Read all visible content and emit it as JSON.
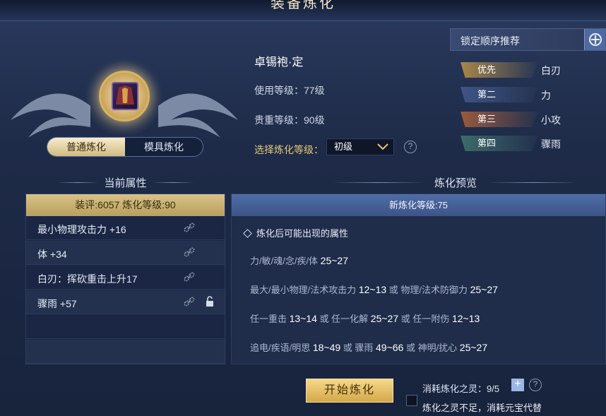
{
  "window": {
    "title": "装备炼化"
  },
  "mode_tabs": [
    {
      "label": "普通炼化",
      "active": true
    },
    {
      "label": "模具炼化",
      "active": false
    }
  ],
  "item": {
    "name": "卓锡袍·定",
    "use_level": "使用等级：77级",
    "value_level": "贵重等级：90级",
    "refine_level_label": "选择炼化等级：",
    "refine_level_selected": "初级"
  },
  "lock_order": {
    "title": "锁定顺序推荐",
    "rows": [
      {
        "tag": "优先",
        "value": "白刃",
        "color": "#a8874a"
      },
      {
        "tag": "第二",
        "value": "力",
        "color": "#3e5585"
      },
      {
        "tag": "第三",
        "value": "小攻",
        "color": "#9a5a3e"
      },
      {
        "tag": "第四",
        "value": "骤雨",
        "color": "#3d6b6a"
      }
    ]
  },
  "current": {
    "heading": "当前属性",
    "header": "装评:6057  炼化等级:90",
    "rows": [
      {
        "text": "最小物理攻击力 +16",
        "locked": false
      },
      {
        "text": "体 +34",
        "locked": false
      },
      {
        "text": "白刃：挥砍重击上升17",
        "locked": false
      },
      {
        "text": "骤雨 +57",
        "locked": true
      }
    ]
  },
  "preview": {
    "heading": "炼化预览",
    "header": "新炼化等级:75",
    "subtitle": "炼化后可能出现的属性",
    "lines": [
      [
        {
          "t": "力/敏/魂/念/疾/体 "
        },
        {
          "t": "25~27",
          "n": true
        }
      ],
      [
        {
          "t": "最大/最小物理/法术攻击力 "
        },
        {
          "t": "12~13",
          "n": true
        },
        {
          "t": " 或 物理/法术防御力 "
        },
        {
          "t": "25~27",
          "n": true
        }
      ],
      [
        {
          "t": "任一重击 "
        },
        {
          "t": "13~14",
          "n": true
        },
        {
          "t": " 或 任一化解 "
        },
        {
          "t": "25~27",
          "n": true
        },
        {
          "t": " 或 任一附伤 "
        },
        {
          "t": "12~13",
          "n": true
        }
      ],
      [
        {
          "t": "追电/疾语/明思 "
        },
        {
          "t": "18~49",
          "n": true
        },
        {
          "t": " 或 骤雨 "
        },
        {
          "t": "49~66",
          "n": true
        },
        {
          "t": " 或 神明/扰心 "
        },
        {
          "t": "25~27",
          "n": true
        }
      ]
    ]
  },
  "bottom": {
    "start_label": "开始炼化",
    "cost_label": "消耗炼化之灵：",
    "cost_value": "9/5",
    "plus": "+",
    "help": "?",
    "warning": "炼化之灵不足，消耗元宝代替"
  }
}
